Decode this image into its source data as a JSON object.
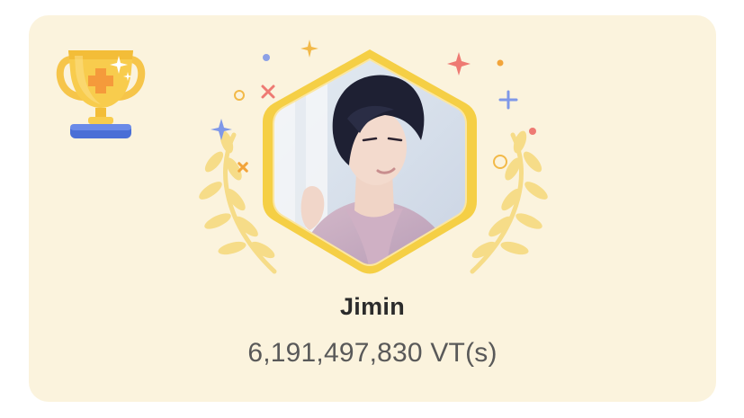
{
  "winner": {
    "name": "Jimin",
    "votes": "6,191,497,830 VT(s)"
  },
  "icons": {
    "trophy": "trophy-icon",
    "laurel": "laurel-wreath",
    "sparkles": "sparkle-decorations"
  },
  "colors": {
    "card_background": "#fbf3dd",
    "frame_gold": "#f5cf45",
    "laurel": "#f6dc88",
    "name_text": "#2b2b2b",
    "votes_text": "#595959",
    "sparkle_blue": "#7f98e8",
    "sparkle_red": "#ee7a73",
    "sparkle_orange": "#f2a43a"
  }
}
